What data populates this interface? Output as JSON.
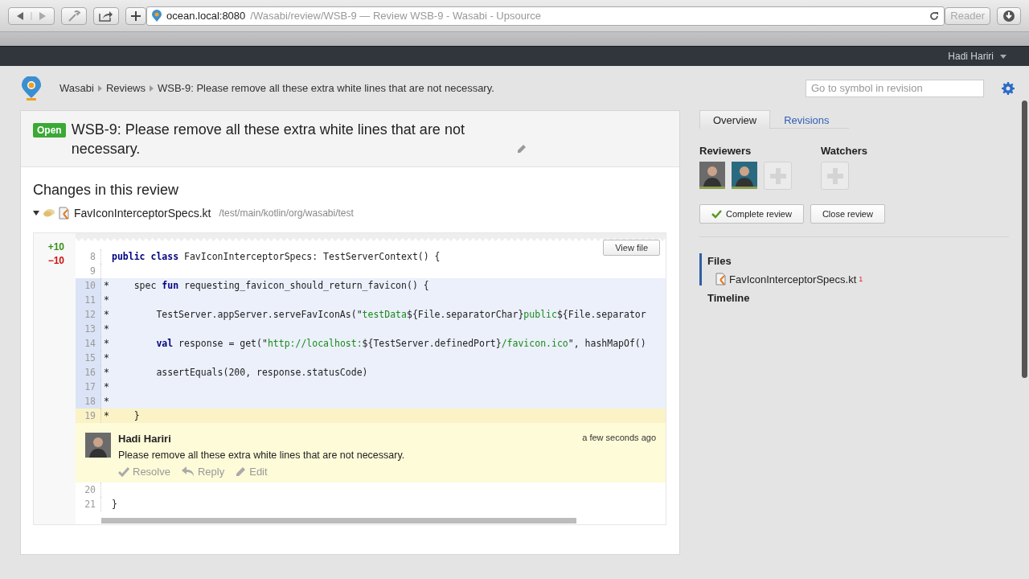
{
  "browser": {
    "url_host": "ocean.local:8080",
    "url_rest": "/Wasabi/review/WSB-9 — Review WSB-9 - Wasabi - Upsource",
    "reader": "Reader"
  },
  "topbar": {
    "user": "Hadi Hariri"
  },
  "header": {
    "breadcrumbs": [
      "Wasabi",
      "Reviews",
      "WSB-9: Please remove all these extra white lines that are not necessary."
    ],
    "search": {
      "placeholder": "Go to symbol in revision"
    }
  },
  "review": {
    "status": "Open",
    "title": "WSB-9: Please remove all these extra white lines that are not necessary."
  },
  "changes": {
    "heading": "Changes in this review",
    "file": {
      "name": "FavIconInterceptorSpecs.kt",
      "path": "/test/main/kotlin/org/wasabi/test",
      "expanded": true
    },
    "added": "+10",
    "removed": "−10",
    "view_file": "View file",
    "lines": [
      {
        "number": "8",
        "kind": "context",
        "tokens": [
          {
            "t": "public class ",
            "kind": "keyword"
          },
          {
            "t": "FavIconInterceptorSpecs: TestServerContext() {",
            "kind": "plain"
          }
        ]
      },
      {
        "number": "9",
        "kind": "context"
      },
      {
        "number": "10",
        "kind": "changed",
        "marker": "*",
        "tokens": [
          {
            "t": "    spec ",
            "kind": "plain"
          },
          {
            "t": "fun ",
            "kind": "keyword"
          },
          {
            "t": "requesting_favicon_should_return_favicon() {",
            "kind": "plain"
          }
        ]
      },
      {
        "number": "11",
        "kind": "changed",
        "marker": "*"
      },
      {
        "number": "12",
        "kind": "changed",
        "marker": "*",
        "tokens": [
          {
            "t": "        TestServer.appServer.serveFavIconAs(\"",
            "kind": "plain"
          },
          {
            "t": "testData",
            "kind": "string"
          },
          {
            "t": "${File.separatorChar}",
            "kind": "plain"
          },
          {
            "t": "public",
            "kind": "string"
          },
          {
            "t": "${File.separator",
            "kind": "plain"
          }
        ]
      },
      {
        "number": "13",
        "kind": "changed",
        "marker": "*"
      },
      {
        "number": "14",
        "kind": "changed",
        "marker": "*",
        "tokens": [
          {
            "t": "        val ",
            "kind": "keyword"
          },
          {
            "t": "response = get(\"",
            "kind": "plain"
          },
          {
            "t": "http://localhost:",
            "kind": "string"
          },
          {
            "t": "${TestServer.definedPort}",
            "kind": "plain"
          },
          {
            "t": "/favicon.ico",
            "kind": "string"
          },
          {
            "t": "\", hashMapOf()",
            "kind": "plain"
          }
        ]
      },
      {
        "number": "15",
        "kind": "changed",
        "marker": "*"
      },
      {
        "number": "16",
        "kind": "changed",
        "marker": "*",
        "tokens": [
          {
            "t": "        assertEquals(200, response.statusCode)",
            "kind": "plain"
          }
        ]
      },
      {
        "number": "17",
        "kind": "changed",
        "marker": "*"
      },
      {
        "number": "18",
        "kind": "changed",
        "marker": "*"
      },
      {
        "number": "19",
        "kind": "commented",
        "marker": "*",
        "tokens": [
          {
            "t": "    }",
            "kind": "plain"
          }
        ]
      }
    ],
    "comment": {
      "author": "Hadi Hariri",
      "time": "a few seconds ago",
      "text": "Please remove all these extra white lines that are not necessary.",
      "actions": [
        {
          "label": "Resolve",
          "kind": "resolve"
        },
        {
          "label": "Reply",
          "kind": "reply"
        },
        {
          "label": "Edit",
          "kind": "edit"
        }
      ]
    },
    "lines_after": [
      {
        "number": "20",
        "kind": "context"
      },
      {
        "number": "21",
        "kind": "context",
        "tokens": [
          {
            "t": "}",
            "kind": "plain"
          }
        ]
      }
    ]
  },
  "sidebar": {
    "tabs": [
      {
        "label": "Overview",
        "selected": true
      },
      {
        "label": "Revisions",
        "selected": false
      }
    ],
    "reviewers": {
      "heading": "Reviewers",
      "avatars": [
        {
          "approved": true
        },
        {
          "approved": true
        }
      ]
    },
    "watchers": {
      "heading": "Watchers"
    },
    "buttons": [
      {
        "label": "Complete review",
        "kind": "complete"
      },
      {
        "label": "Close review",
        "kind": "plain"
      }
    ],
    "nav": [
      {
        "label": "Files",
        "selected": true,
        "files": [
          {
            "name": "FavIconInterceptorSpecs.kt",
            "count": "1"
          }
        ]
      },
      {
        "label": "Timeline",
        "selected": false
      }
    ]
  }
}
